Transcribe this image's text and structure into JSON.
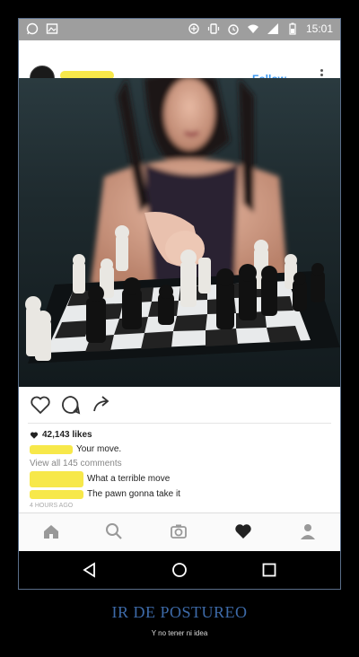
{
  "status_bar": {
    "time": "15:01"
  },
  "post": {
    "follow_label": "Follow",
    "likes": "42,143 likes",
    "caption": "Your move.",
    "view_all": "View all 145 comments",
    "comments": [
      {
        "text": "What a terrible move"
      },
      {
        "text": "The pawn gonna take it"
      }
    ],
    "time_ago": "4 HOURS AGO"
  },
  "meme": {
    "title": "IR DE POSTUREO",
    "subtitle": "Y no tener ni idea"
  }
}
